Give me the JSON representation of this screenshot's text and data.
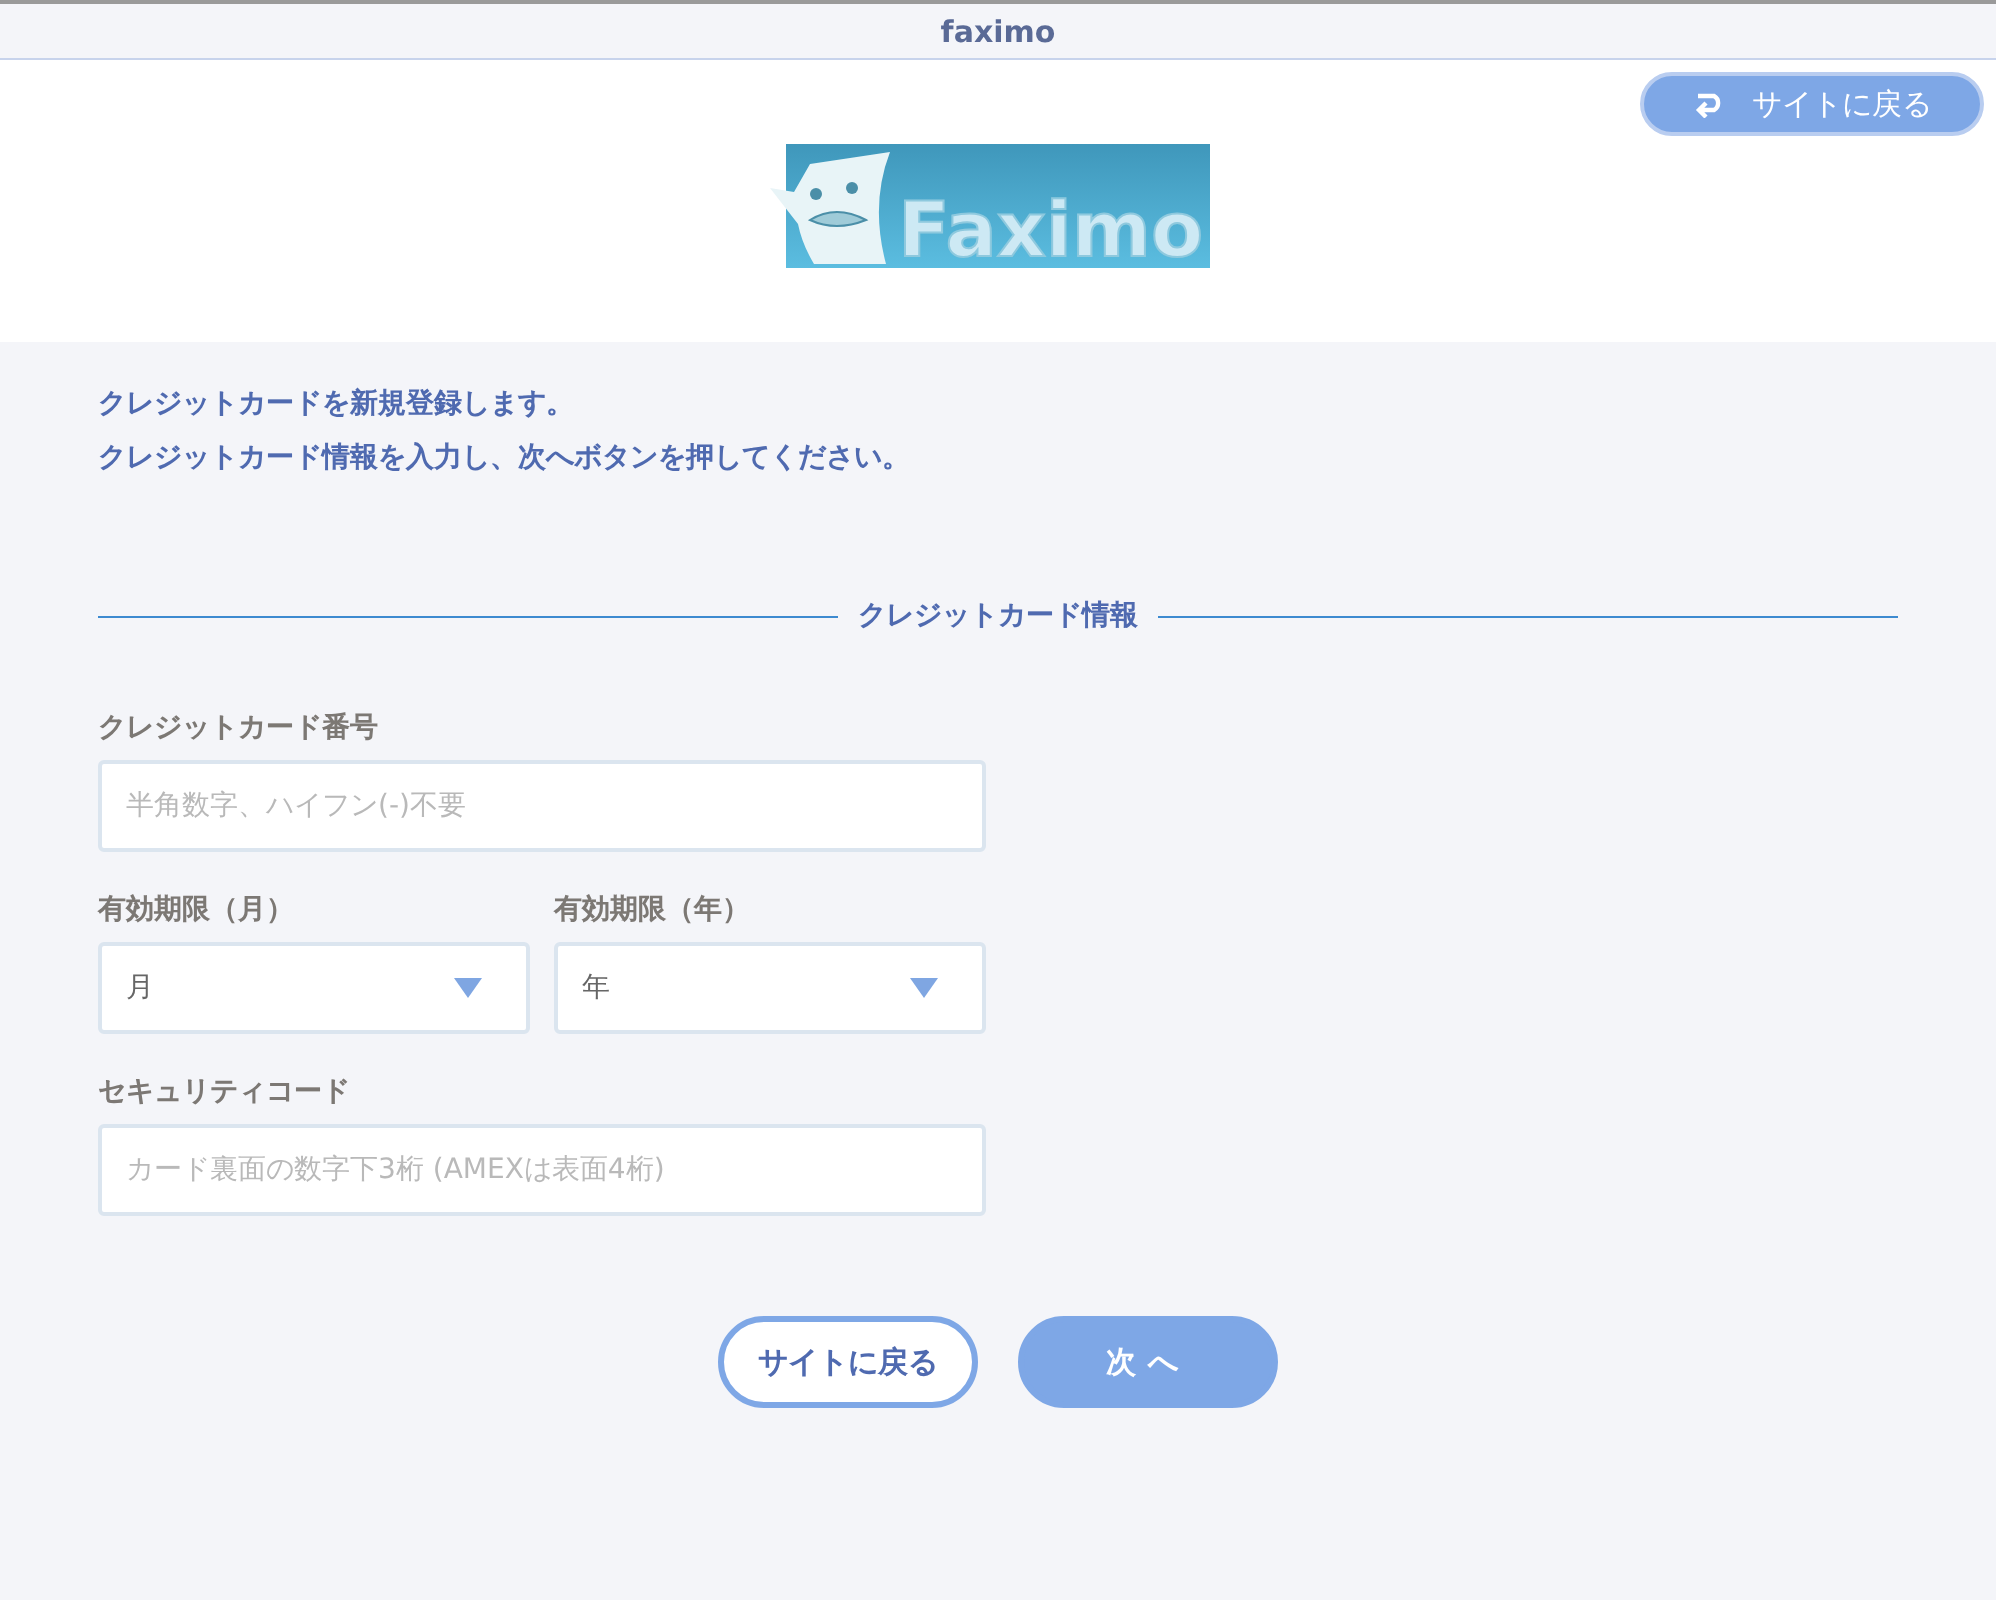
{
  "window": {
    "title": "faximo"
  },
  "header": {
    "back_button": "サイトに戻る",
    "logo_text": "Faximo"
  },
  "intro": [
    "クレジットカードを新規登録します。",
    "クレジットカード情報を入力し、次へボタンを押してください。"
  ],
  "section_title": "クレジットカード情報",
  "fields": [
    {
      "kind": "text",
      "label": "クレジットカード番号",
      "placeholder": "半角数字、ハイフン(-)不要"
    },
    {
      "kind": "selects",
      "items": [
        {
          "label": "有効期限（月）",
          "value": "月"
        },
        {
          "label": "有効期限（年）",
          "value": "年"
        }
      ]
    },
    {
      "kind": "text",
      "label": "セキュリティコード",
      "placeholder": "カード裏面の数字下3桁 (AMEXは表面4桁)"
    }
  ],
  "buttons": [
    {
      "label": "サイトに戻る",
      "primary": false
    },
    {
      "label": "次へ",
      "primary": true
    }
  ]
}
